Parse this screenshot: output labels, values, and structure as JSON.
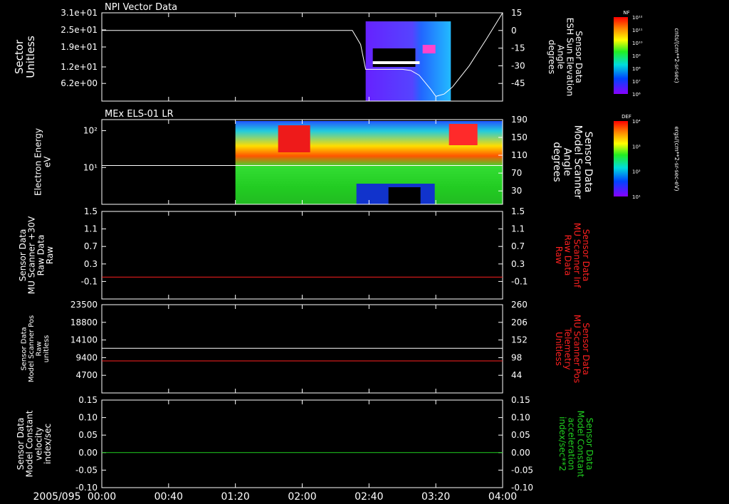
{
  "date_label": "2005/095",
  "time_axis": {
    "tick_labels": [
      "00:00",
      "00:40",
      "01:20",
      "02:00",
      "02:40",
      "03:20",
      "04:00"
    ],
    "tick_minutes": [
      0,
      40,
      80,
      120,
      160,
      200,
      240
    ],
    "range_minutes": [
      0,
      240
    ]
  },
  "chart_data": [
    {
      "type": "heatmap",
      "title": "NPI Vector Data",
      "ylabel": [
        "Sector",
        "Unitless"
      ],
      "ytick_labels": [
        "3.1e+01",
        "2.5e+01",
        "1.9e+01",
        "1.2e+01",
        "6.2e+00"
      ],
      "ytick_values": [
        31,
        25,
        19,
        12,
        6.2
      ],
      "ylim": [
        0,
        31
      ],
      "y2label": [
        "Sensor Data",
        "ESH Sun Elevation",
        "Angle",
        "degrees"
      ],
      "y2tick_labels": [
        "15",
        "0",
        "-15",
        "-30",
        "-45"
      ],
      "y2tick_values": [
        15,
        0,
        -15,
        -30,
        -45
      ],
      "y2lim": [
        -60,
        15
      ],
      "data_span_minutes": [
        158,
        209
      ],
      "series": [
        {
          "name": "ESH Sun Elevation Angle",
          "color": "#ffffff",
          "x": [
            0,
            150,
            155,
            158,
            170,
            180,
            185,
            190,
            197,
            200,
            205,
            210,
            220,
            230,
            240
          ],
          "y": [
            0,
            0,
            -12,
            -33,
            -33,
            -33,
            -34,
            -38,
            -50,
            -56,
            -54,
            -48,
            -30,
            -8,
            15
          ]
        }
      ],
      "colorbar": {
        "label": "NF",
        "unit": "cnts/(cm**2-sr-sec)",
        "tick_labels": [
          "10¹²",
          "10¹¹",
          "10¹⁰",
          "10⁹",
          "10⁸",
          "10⁷",
          "10⁶"
        ]
      }
    },
    {
      "type": "heatmap",
      "title": "MEx ELS-01 LR",
      "ylabel": [
        "Electron Energy",
        "eV"
      ],
      "ytick_labels": [
        "10²",
        "10¹"
      ],
      "ytick_values": [
        100,
        10
      ],
      "ylim_log": [
        1,
        200
      ],
      "y2label": [
        "Sensor Data",
        "Model Scanner",
        "Angle",
        "degrees"
      ],
      "y2tick_labels": [
        "190",
        "150",
        "110",
        "70",
        "30"
      ],
      "y2tick_values": [
        190,
        150,
        110,
        70,
        30
      ],
      "y2lim": [
        0,
        190
      ],
      "data_span_minutes": [
        80,
        240
      ],
      "series": [
        {
          "name": "Model Scanner Angle",
          "color": "#ffffff",
          "x": [
            0,
            240
          ],
          "y": [
            87,
            87
          ]
        }
      ],
      "colorbar": {
        "label": "DEF",
        "unit": "ergs/(cm**2-sr-sec-eV)",
        "tick_labels": [
          "10⁴",
          "10³",
          "10²",
          "10¹"
        ]
      }
    },
    {
      "type": "line",
      "ylabel": [
        "Sensor Data",
        "MU Scanner +30V",
        "Raw Data",
        "Raw"
      ],
      "ytick_labels": [
        "1.5",
        "1.1",
        "0.7",
        "0.3",
        "-0.1"
      ],
      "ytick_values": [
        1.5,
        1.1,
        0.7,
        0.3,
        -0.1
      ],
      "ylim": [
        -0.5,
        1.5
      ],
      "y2label": [
        "Sensor Data",
        "MU Scanner Inf",
        "Raw Data",
        "Raw"
      ],
      "y2tick_labels": [
        "1.5",
        "1.1",
        "0.7",
        "0.3",
        "-0.1"
      ],
      "y2tick_values": [
        1.5,
        1.1,
        0.7,
        0.3,
        -0.1
      ],
      "y2lim": [
        -0.5,
        1.5
      ],
      "series": [
        {
          "name": "MU Scanner Inf Raw Data",
          "color": "#ff2020",
          "axis": "right",
          "x": [
            0,
            240
          ],
          "y": [
            0,
            0
          ]
        }
      ]
    },
    {
      "type": "line",
      "ylabel": [
        "Sensor Data",
        "Model Scanner Pos",
        "Raw",
        "unitless"
      ],
      "ytick_labels": [
        "23500",
        "18800",
        "14100",
        "9400",
        "4700"
      ],
      "ytick_values": [
        23500,
        18800,
        14100,
        9400,
        4700
      ],
      "ylim": [
        0,
        23500
      ],
      "y2label": [
        "Sensor Data",
        "MU Scanner Pos",
        "Telemetry",
        "Unitless"
      ],
      "y2tick_labels": [
        "260",
        "206",
        "152",
        "98",
        "44"
      ],
      "y2tick_values": [
        260,
        206,
        152,
        98,
        44
      ],
      "y2lim": [
        -10,
        260
      ],
      "series": [
        {
          "name": "Model Scanner Pos Raw",
          "color": "#ffffff",
          "axis": "left",
          "x": [
            0,
            240
          ],
          "y": [
            11900,
            11900
          ]
        },
        {
          "name": "MU Scanner Pos Telemetry",
          "color": "#ff2020",
          "axis": "right",
          "x": [
            0,
            240
          ],
          "y": [
            88,
            88
          ]
        }
      ]
    },
    {
      "type": "line",
      "ylabel": [
        "Sensor Data",
        "Model Constant",
        "velocity",
        "index/sec"
      ],
      "ytick_labels": [
        "0.15",
        "0.10",
        "0.05",
        "0.00",
        "-0.05",
        "-0.10"
      ],
      "ytick_values": [
        0.15,
        0.1,
        0.05,
        0.0,
        -0.05,
        -0.1
      ],
      "ylim": [
        -0.1,
        0.15
      ],
      "y2label": [
        "Sensor Data",
        "Model Constant",
        "acceleration",
        "index/sec**2"
      ],
      "y2tick_labels": [
        "0.15",
        "0.10",
        "0.05",
        "0.00",
        "-0.05",
        "-0.10"
      ],
      "y2tick_values": [
        0.15,
        0.1,
        0.05,
        0.0,
        -0.05,
        -0.1
      ],
      "y2lim": [
        -0.1,
        0.15
      ],
      "series": [
        {
          "name": "Model Constant acceleration",
          "color": "#20d020",
          "axis": "right",
          "x": [
            0,
            240
          ],
          "y": [
            0,
            0
          ]
        }
      ]
    }
  ]
}
